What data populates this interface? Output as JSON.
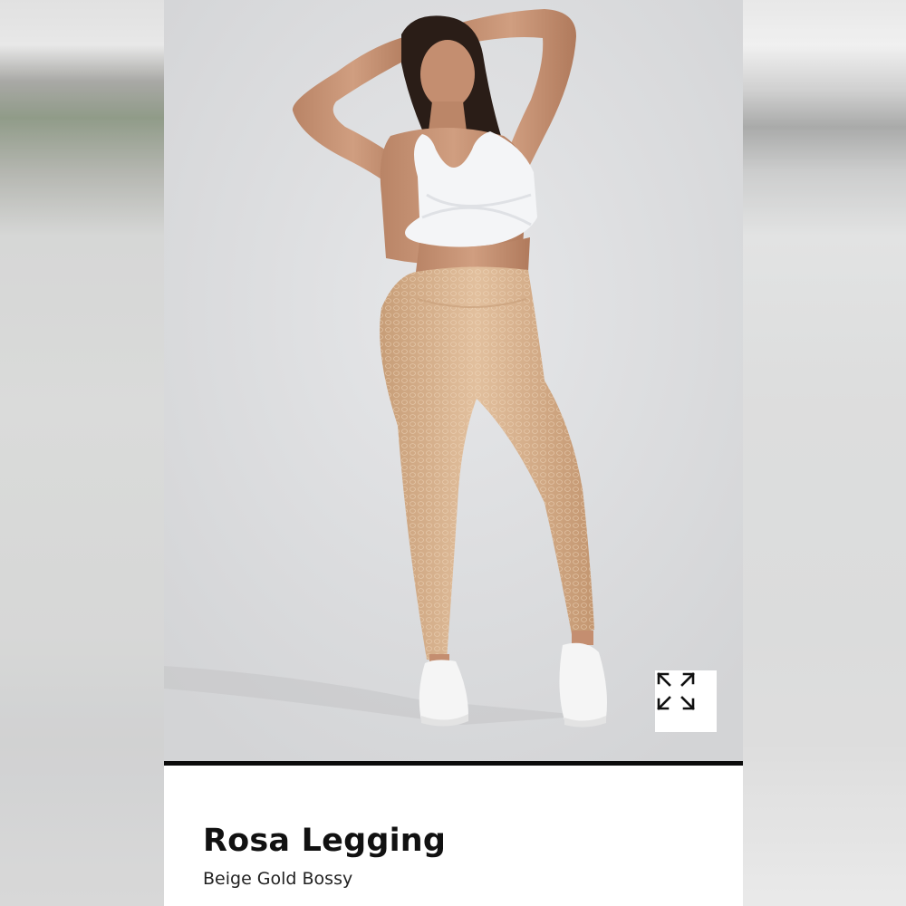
{
  "product": {
    "name": "Rosa Legging",
    "variant": "Beige Gold Bossy"
  },
  "image": {
    "expand_button_icon": "expand-arrows-icon"
  },
  "colors": {
    "divider": "#0b0b0b",
    "card_background": "#ffffff",
    "legging": "#d9b48f",
    "top": "#f4f5f7"
  }
}
